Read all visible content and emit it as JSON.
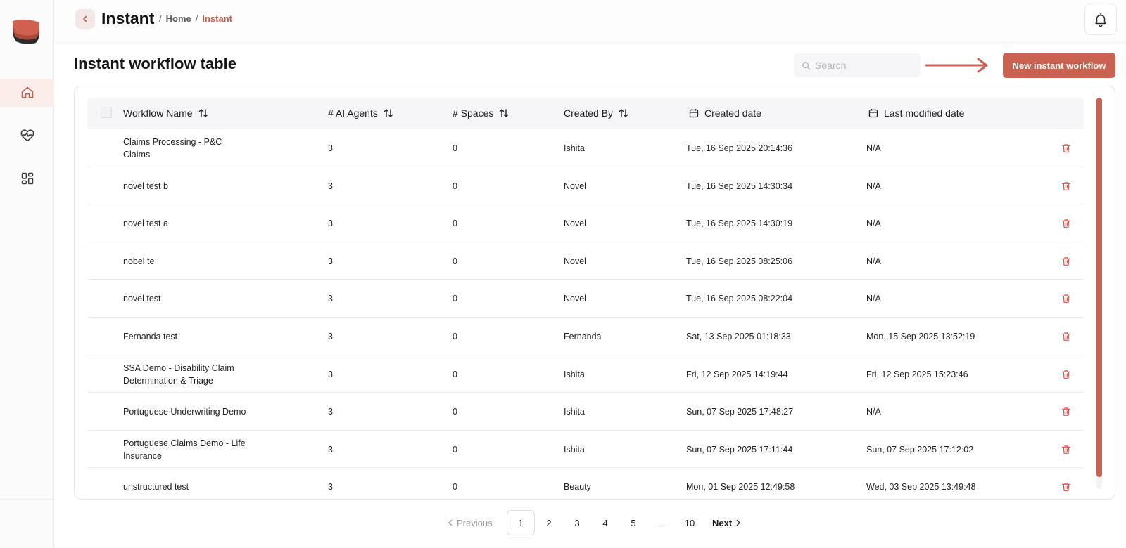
{
  "header": {
    "title": "Instant",
    "breadcrumb": {
      "home": "Home",
      "current": "Instant",
      "separator": "/"
    }
  },
  "sidebar": {
    "items": [
      {
        "name": "home",
        "icon": "home-icon",
        "active": true
      },
      {
        "name": "health",
        "icon": "heart-pulse-icon",
        "active": false
      },
      {
        "name": "apps",
        "icon": "grid-icon",
        "active": false
      }
    ]
  },
  "main": {
    "title": "Instant workflow table",
    "search_placeholder": "Search",
    "new_button_label": "New instant workflow"
  },
  "table": {
    "columns": [
      "Workflow Name",
      "# AI Agents",
      "# Spaces",
      "Created By",
      "Created date",
      "Last modified date"
    ],
    "rows": [
      {
        "name": "Claims Processing - P&C Claims",
        "agents": "3",
        "spaces": "0",
        "created_by": "Ishita",
        "created": "Tue, 16 Sep 2025 20:14:36",
        "modified": "N/A"
      },
      {
        "name": "novel test b",
        "agents": "3",
        "spaces": "0",
        "created_by": "Novel",
        "created": "Tue, 16 Sep 2025 14:30:34",
        "modified": "N/A"
      },
      {
        "name": "novel test a",
        "agents": "3",
        "spaces": "0",
        "created_by": "Novel",
        "created": "Tue, 16 Sep 2025 14:30:19",
        "modified": "N/A"
      },
      {
        "name": "nobel te",
        "agents": "3",
        "spaces": "0",
        "created_by": "Novel",
        "created": "Tue, 16 Sep 2025 08:25:06",
        "modified": "N/A"
      },
      {
        "name": "novel test",
        "agents": "3",
        "spaces": "0",
        "created_by": "Novel",
        "created": "Tue, 16 Sep 2025 08:22:04",
        "modified": "N/A"
      },
      {
        "name": "Fernanda test",
        "agents": "3",
        "spaces": "0",
        "created_by": "Fernanda",
        "created": "Sat, 13 Sep 2025 01:18:33",
        "modified": "Mon, 15 Sep 2025 13:52:19"
      },
      {
        "name": "SSA Demo - Disability Claim Determination & Triage",
        "agents": "3",
        "spaces": "0",
        "created_by": "Ishita",
        "created": "Fri, 12 Sep 2025 14:19:44",
        "modified": "Fri, 12 Sep 2025 15:23:46"
      },
      {
        "name": "Portuguese Underwriting Demo",
        "agents": "3",
        "spaces": "0",
        "created_by": "Ishita",
        "created": "Sun, 07 Sep 2025 17:48:27",
        "modified": "N/A"
      },
      {
        "name": "Portuguese Claims Demo - Life Insurance",
        "agents": "3",
        "spaces": "0",
        "created_by": "Ishita",
        "created": "Sun, 07 Sep 2025 17:11:44",
        "modified": "Sun, 07 Sep 2025 17:12:02"
      },
      {
        "name": "unstructured test",
        "agents": "3",
        "spaces": "0",
        "created_by": "Beauty",
        "created": "Mon, 01 Sep 2025 12:49:58",
        "modified": "Wed, 03 Sep 2025 13:49:48"
      }
    ]
  },
  "pagination": {
    "previous_label": "Previous",
    "next_label": "Next",
    "pages": [
      "1",
      "2",
      "3",
      "4",
      "5"
    ],
    "ellipsis": "...",
    "last_page": "10",
    "current_page": "1"
  },
  "colors": {
    "accent": "#c96250",
    "accent_text": "#c25d4a",
    "active_nav_bg": "#f9ece9",
    "delete_icon": "#d9534f"
  }
}
